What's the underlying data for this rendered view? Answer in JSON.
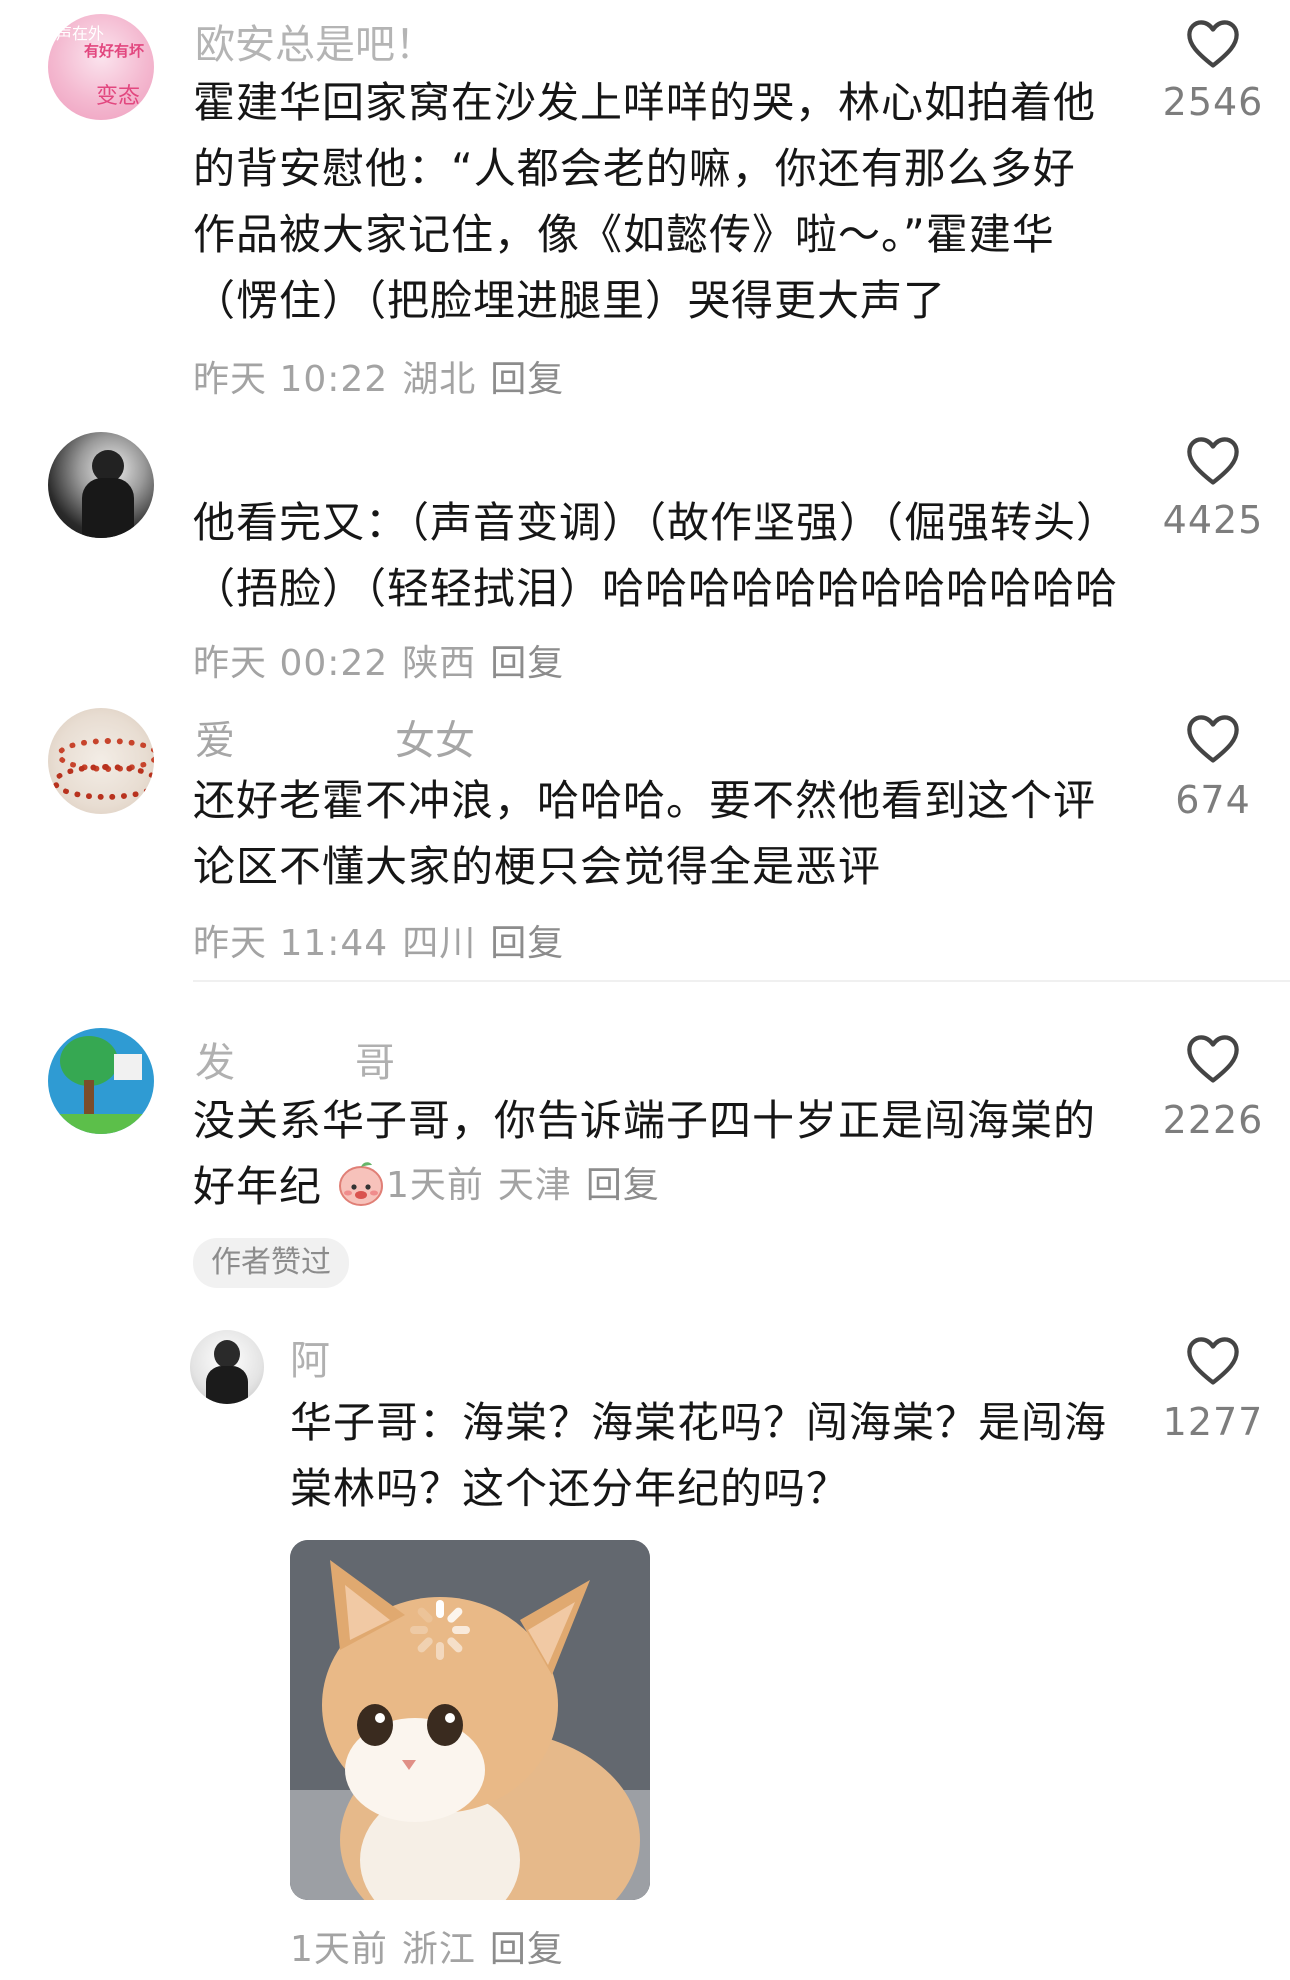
{
  "comments": [
    {
      "username": "欧安总是吧！",
      "avatar_text": [
        "声在外",
        "有好有坏",
        "变态"
      ],
      "text": "霍建华回家窝在沙发上咩咩的哭，林心如拍着他的背安慰他：“人都会老的嘛，你还有那么多好作品被大家记住，像《如懿传》啦～。”霍建华（愣住）（把脸埋进腿里）哭得更大声了",
      "time": "昨天 10:22",
      "location": "湖北",
      "reply_label": "回复",
      "likes": "2546"
    },
    {
      "username": "",
      "text": "他看完又：（声音变调）（故作坚强）（倔强转头）（捂脸）（轻轻拭泪）哈哈哈哈哈哈哈哈哈哈哈哈",
      "time": "昨天 00:22",
      "location": "陕西",
      "reply_label": "回复",
      "likes": "4425"
    },
    {
      "username": "爱　　　　女女",
      "text": "还好老霍不冲浪，哈哈哈。要不然他看到这个评论区不懂大家的梗只会觉得全是恶评",
      "time": "昨天 11:44",
      "location": "四川",
      "reply_label": "回复",
      "likes": "674"
    },
    {
      "username": "发　　　哥",
      "text": "没关系华子哥，你告诉端子四十岁正是闯海棠的好年纪",
      "time": "1天前",
      "location": "天津",
      "reply_label": "回复",
      "likes": "2226",
      "badge": "作者赞过"
    },
    {
      "username": "阿　　　　",
      "text": "华子哥：海棠？海棠花吗？闯海棠？是闯海棠林吗？这个还分年纪的吗？",
      "time": "1天前",
      "location": "浙江",
      "reply_label": "回复",
      "likes": "1277"
    }
  ],
  "icons": {
    "like": "heart-outline-icon",
    "emoji": "peach-face-emoji-icon"
  },
  "colors": {
    "text": "#161616",
    "meta": "#a3a3a3",
    "likes": "#7d7d7d",
    "badge_bg": "#f1f1f1"
  }
}
